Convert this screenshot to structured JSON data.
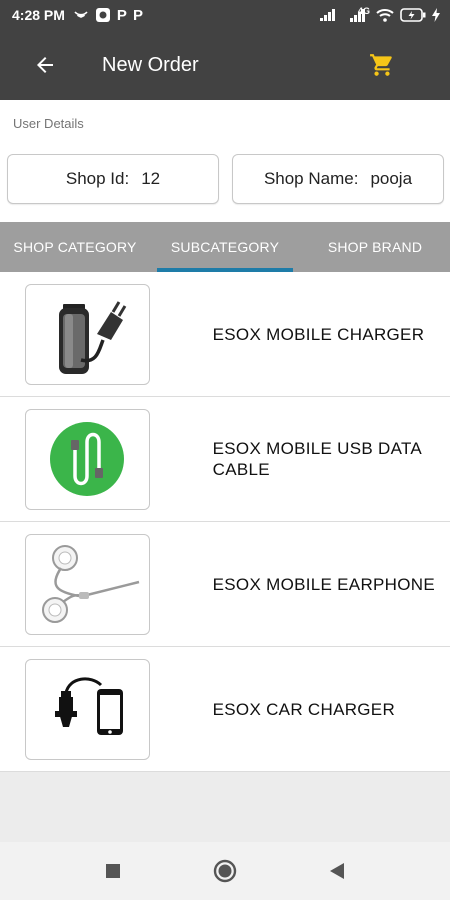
{
  "status_bar": {
    "time": "4:28 PM",
    "badge_letter_1": "P",
    "badge_letter_2": "P",
    "network_label": "4G"
  },
  "app_bar": {
    "title": "New Order"
  },
  "user_details": {
    "section_label": "User Details",
    "shop_id_label": "Shop Id:",
    "shop_id_value": "12",
    "shop_name_label": "Shop Name:",
    "shop_name_value": "pooja"
  },
  "tabs": [
    {
      "label": "SHOP CATEGORY",
      "active": false
    },
    {
      "label": "SUBCATEGORY",
      "active": true
    },
    {
      "label": "SHOP BRAND",
      "active": false
    }
  ],
  "products": [
    {
      "name": "ESOX MOBILE CHARGER",
      "icon": "charger-icon"
    },
    {
      "name": "ESOX MOBILE USB DATA CABLE",
      "icon": "usb-cable-icon"
    },
    {
      "name": "ESOX MOBILE EARPHONE",
      "icon": "earphone-icon"
    },
    {
      "name": "ESOX CAR CHARGER",
      "icon": "car-charger-icon"
    }
  ],
  "colors": {
    "app_bar": "#424242",
    "cart_accent": "#f5c518",
    "tab_bar": "#9e9e9e",
    "tab_indicator": "#1e7ca8",
    "cable_green": "#3bb54a"
  }
}
